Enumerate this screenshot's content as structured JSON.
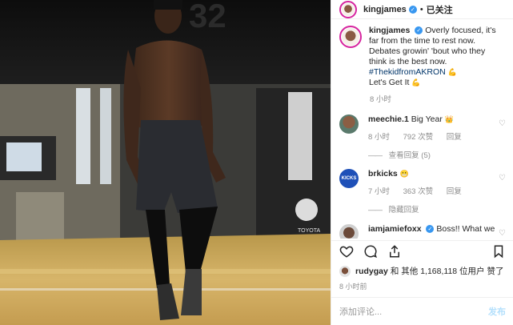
{
  "header": {
    "username": "kingjames",
    "follow_label": "已关注",
    "separator": "•"
  },
  "caption": {
    "username": "kingjames",
    "text": "Overly focused, it's far from the time to rest now. Debates growin' 'bout who they think is the best now.",
    "hashtag": "#ThekidfromAKRON",
    "text_after": "Let's Get It",
    "time": "8 小时"
  },
  "comments": [
    {
      "username": "meechie.1",
      "text": "Big Year",
      "time": "8 小时",
      "likes": "792 次赞",
      "reply": "回复",
      "view_replies": "查看回复 (5)"
    },
    {
      "username": "brkicks",
      "text": "",
      "time": "7 小时",
      "likes": "363 次赞",
      "reply": "回复",
      "view_replies": "隐藏回复"
    },
    {
      "username": "iamjamiefoxx",
      "text": "Boss!! What we"
    }
  ],
  "likes": {
    "user": "rudygay",
    "text": "和 其他 1,168,118 位用户 赞了"
  },
  "post_time": "8 小时前",
  "add_comment": {
    "placeholder": "添加评论...",
    "post_label": "发布"
  },
  "photo": {
    "wall_number": "32",
    "sign_text": "TOYOTA"
  },
  "colors": {
    "link": "#003569",
    "verified": "#3897f0",
    "meta": "#8e8e8e"
  }
}
